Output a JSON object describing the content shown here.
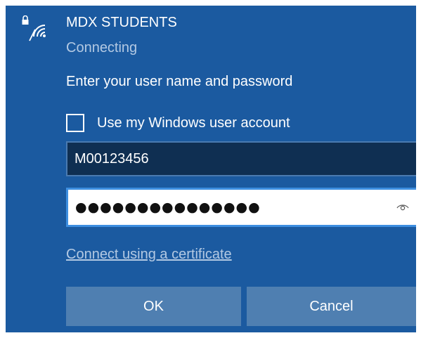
{
  "network": {
    "name": "MDX STUDENTS",
    "status": "Connecting",
    "icon": "wifi-secured-icon"
  },
  "auth": {
    "prompt": "Enter your user name and password",
    "use_windows_account_label": "Use my Windows user account",
    "use_windows_account_checked": false,
    "username_value": "M00123456",
    "password_masked": "●●●●●●●●●●●●●●●",
    "reveal_icon": "eye-icon",
    "certificate_link": "Connect using a certificate"
  },
  "buttons": {
    "ok_label": "OK",
    "cancel_label": "Cancel"
  },
  "colors": {
    "panel_bg": "#1b5aa0",
    "input_dark_bg": "#0f2f52",
    "input_focus_border": "#3d8ee0",
    "button_bg": "#4f7fb1",
    "muted_text": "#b3c9e3"
  }
}
